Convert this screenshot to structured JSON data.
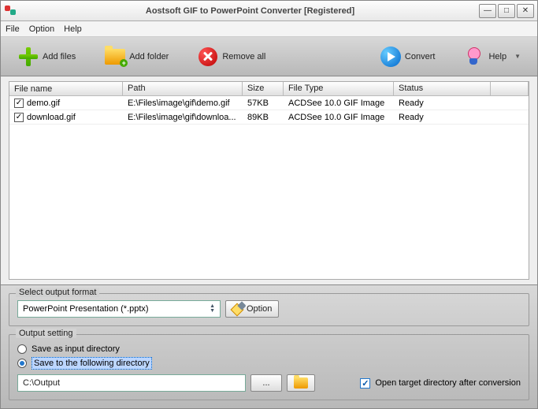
{
  "window": {
    "title": "Aostsoft GIF to PowerPoint Converter [Registered]"
  },
  "menubar": {
    "file": "File",
    "option": "Option",
    "help": "Help"
  },
  "toolbar": {
    "add_files": "Add files",
    "add_folder": "Add folder",
    "remove_all": "Remove all",
    "convert": "Convert",
    "help": "Help"
  },
  "columns": {
    "filename": "File name",
    "path": "Path",
    "size": "Size",
    "filetype": "File Type",
    "status": "Status"
  },
  "rows": [
    {
      "checked": true,
      "filename": "demo.gif",
      "path": "E:\\Files\\image\\gif\\demo.gif",
      "size": "57KB",
      "filetype": "ACDSee 10.0 GIF Image",
      "status": "Ready"
    },
    {
      "checked": true,
      "filename": "download.gif",
      "path": "E:\\Files\\image\\gif\\downloa...",
      "size": "89KB",
      "filetype": "ACDSee 10.0 GIF Image",
      "status": "Ready"
    }
  ],
  "output_format": {
    "legend": "Select output format",
    "selected": "PowerPoint Presentation (*.pptx)",
    "option_btn": "Option"
  },
  "output_setting": {
    "legend": "Output setting",
    "save_as_input": "Save as input directory",
    "save_to_following": "Save to the following directory",
    "path": "C:\\Output",
    "browse": "...",
    "open_target": "Open target directory after conversion"
  }
}
